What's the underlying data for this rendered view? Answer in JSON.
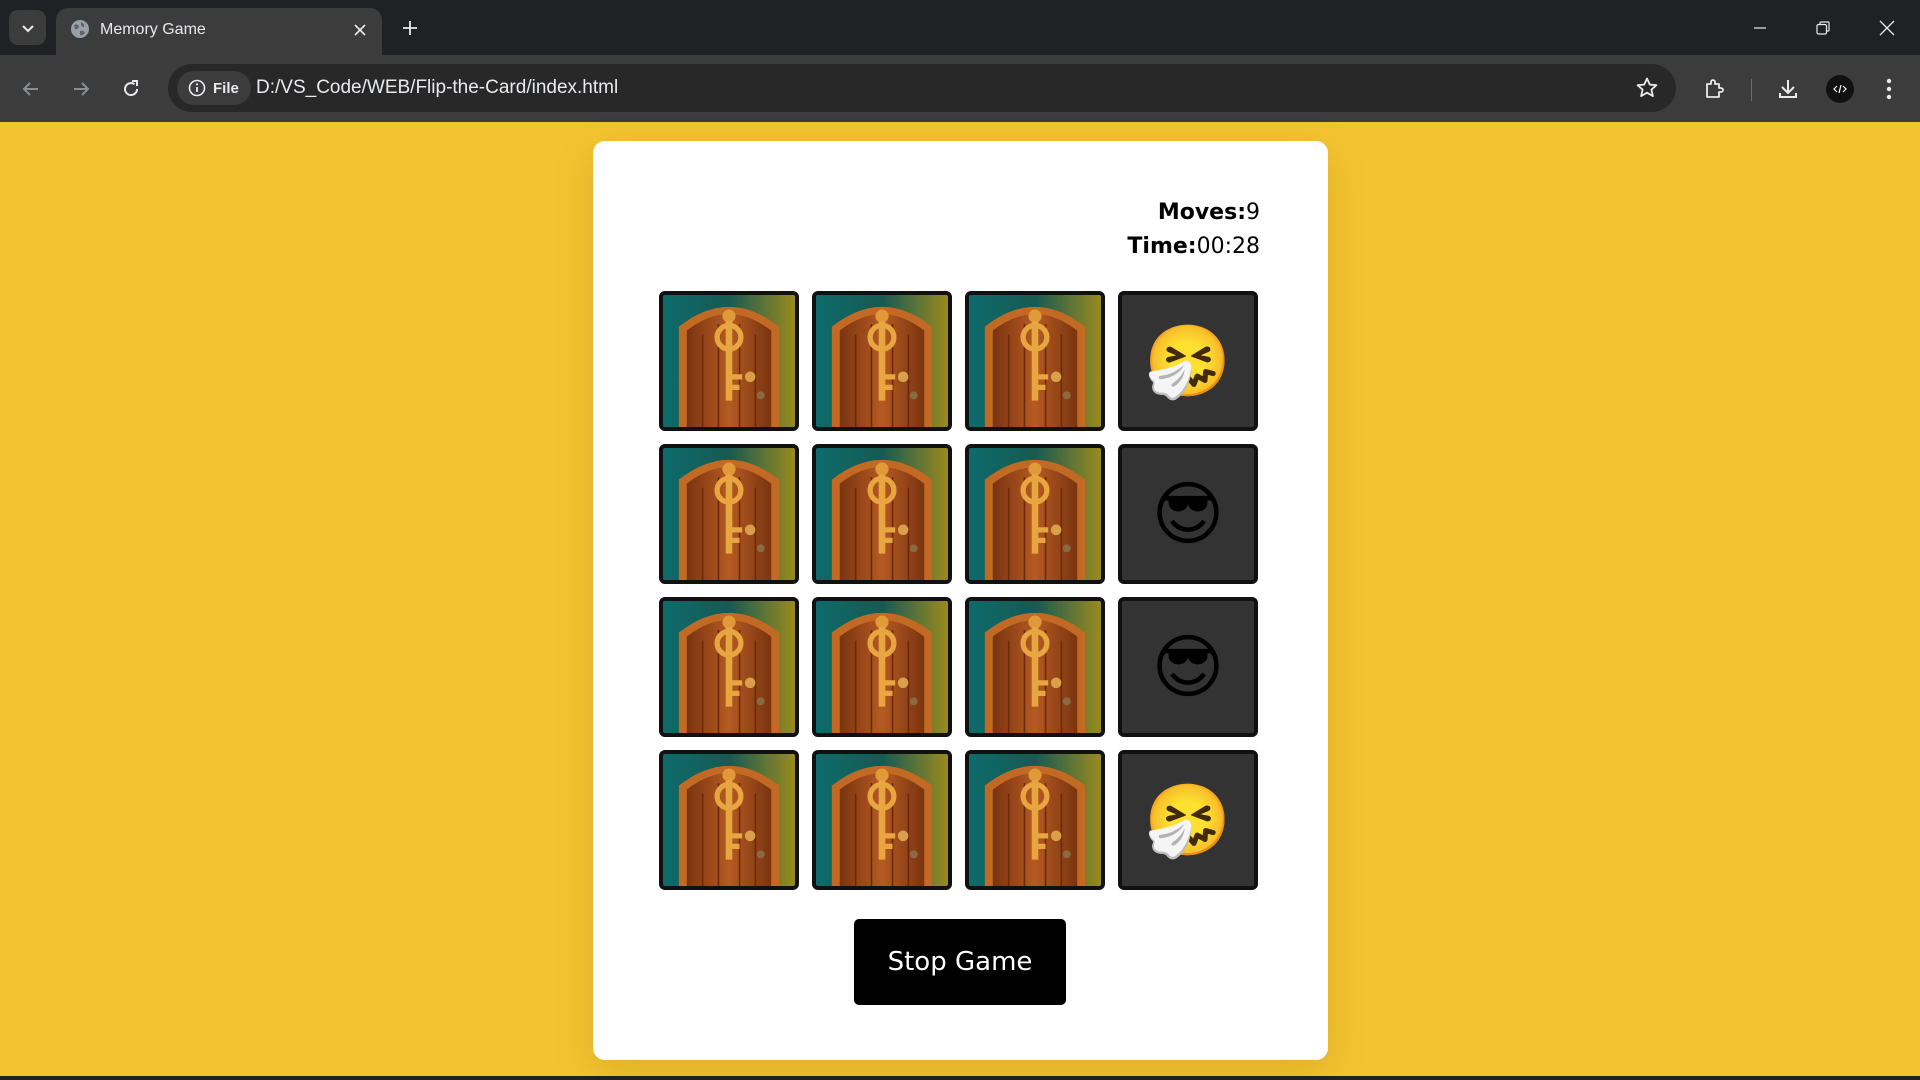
{
  "browser": {
    "tab_title": "Memory Game",
    "site_chip_label": "File",
    "url": "D:/VS_Code/WEB/Flip-the-Card/index.html"
  },
  "game": {
    "moves_label": "Moves:",
    "moves_value": "9",
    "time_label": "Time:",
    "time_value": "00:28",
    "stop_button_label": "Stop Game",
    "grid_columns": 4,
    "grid_rows": 4,
    "cards": [
      {
        "state": "hidden"
      },
      {
        "state": "hidden"
      },
      {
        "state": "hidden"
      },
      {
        "state": "flipped",
        "emoji": "🤧"
      },
      {
        "state": "hidden"
      },
      {
        "state": "hidden"
      },
      {
        "state": "hidden"
      },
      {
        "state": "flipped",
        "emoji": "😎"
      },
      {
        "state": "hidden"
      },
      {
        "state": "hidden"
      },
      {
        "state": "hidden"
      },
      {
        "state": "flipped",
        "emoji": "😎"
      },
      {
        "state": "hidden"
      },
      {
        "state": "hidden"
      },
      {
        "state": "hidden"
      },
      {
        "state": "flipped",
        "emoji": "🤧"
      }
    ]
  },
  "colors": {
    "page_background": "#f4c430",
    "card_panel": "#ffffff",
    "flipped_card": "#333333",
    "button": "#000000"
  }
}
